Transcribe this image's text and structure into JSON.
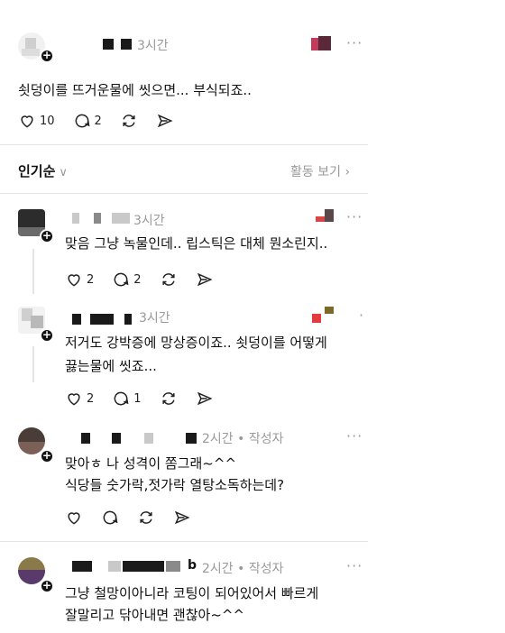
{
  "post": {
    "time": "3시간",
    "text": "쇳덩이를 뜨거운물에 씻으면... 부식되죠..",
    "likes": "10",
    "comments": "2",
    "more": "···"
  },
  "sort": {
    "label": "인기순",
    "chevron": "∨",
    "activity_label": "활동 보기",
    "activity_chevron": "›"
  },
  "replies": [
    {
      "time": "3시간",
      "text": "맞음 그냥 녹물인데.. 립스틱은 대체 뭔소린지..",
      "likes": "2",
      "comments": "2",
      "more": "···"
    },
    {
      "time": "3시간",
      "text_line1": "저거도 강박증에 망상증이죠.. 쇳덩이를 어떻게",
      "text_line2": "끓는물에 씻죠...",
      "likes": "2",
      "comments": "1",
      "more": "·"
    },
    {
      "time": "2시간 • 작성자",
      "text_line1": "맞아ㅎ 나 성격이 쫌그래~^^",
      "text_line2": "식당들 숫가락,젓가락 열탕소독하는데?",
      "more": "···"
    },
    {
      "time": "2시간 • 작성자",
      "name_tail": "b",
      "text_line1": "그냥 철망이아니라 코팅이 되어있어서 빠르게",
      "text_line2": "잘말리고 닦아내면 괜찮아~^^",
      "more": "···"
    }
  ],
  "icons": [
    "heart-icon",
    "comment-icon",
    "repost-icon",
    "share-icon",
    "plus-icon",
    "more-icon"
  ],
  "colors": {
    "text": "#111111",
    "muted": "#9a9a9a",
    "divider": "#e4e4e4"
  }
}
